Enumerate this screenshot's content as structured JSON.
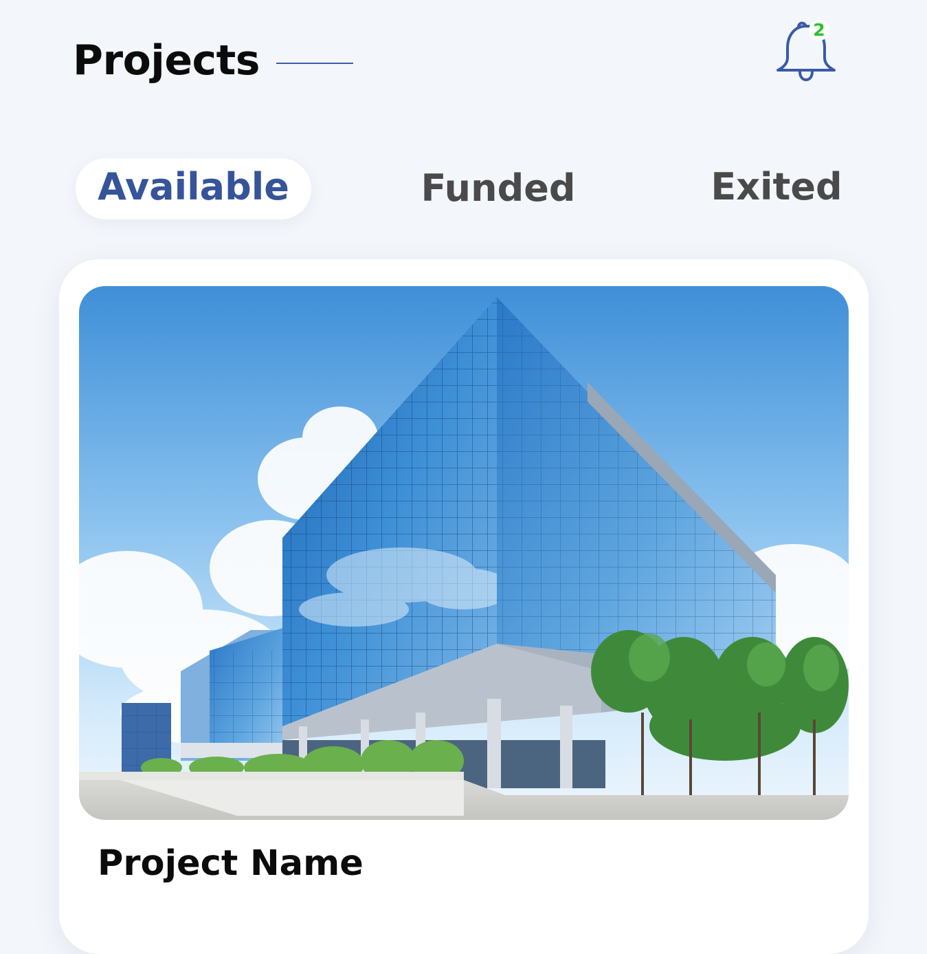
{
  "header": {
    "title": "Projects"
  },
  "notifications": {
    "icon": "bell-icon",
    "count": "2",
    "badge_color": "#27c22c",
    "icon_color": "#3a5aa8"
  },
  "tabs": [
    {
      "label": "Available",
      "active": true
    },
    {
      "label": "Funded",
      "active": false
    },
    {
      "label": "Exited",
      "active": false
    }
  ],
  "colors": {
    "accent": "#36549a",
    "background": "#f3f6fb",
    "card": "#ffffff"
  },
  "project_card": {
    "image": "office-building-photo",
    "name": "Project Name"
  }
}
